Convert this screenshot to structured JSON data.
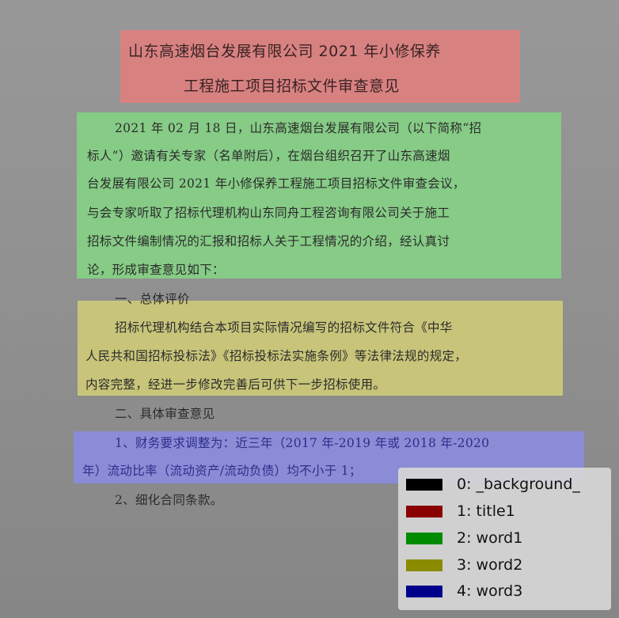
{
  "colors": {
    "background": "#000000",
    "title1": "#8b0000",
    "word1": "#008b00",
    "word2": "#8b8b00",
    "word3": "#00008b"
  },
  "document": {
    "title_lines": [
      "山东高速烟台发展有限公司 2021 年小修保养",
      "工程施工项目招标文件审查意见"
    ],
    "para1_lines": [
      "2021 年 02 月 18 日，山东高速烟台发展有限公司（以下简称“招",
      "标人”）邀请有关专家（名单附后），在烟台组织召开了山东高速烟",
      "台发展有限公司 2021 年小修保养工程施工项目招标文件审查会议，",
      "与会专家听取了招标代理机构山东同舟工程咨询有限公司关于施工",
      "招标文件编制情况的汇报和招标人关于工程情况的介绍，经认真讨",
      "论，形成审查意见如下："
    ],
    "heading1": "一、总体评价",
    "para2_lines": [
      "招标代理机构结合本项目实际情况编写的招标文件符合《中华",
      "人民共和国招标投标法》《招标投标法实施条例》等法律法规的规定，",
      "内容完整，经进一步修改完善后可供下一步招标使用。"
    ],
    "heading2": "二、具体审查意见",
    "para3_lines": [
      "1、财务要求调整为：近三年（2017 年-2019 年或 2018 年-2020",
      "年）流动比率（流动资产/流动负债）均不小于 1；"
    ],
    "item2": "2、细化合同条款。"
  },
  "legend": [
    {
      "label": "0: _background_",
      "color": "#000000"
    },
    {
      "label": "1: title1",
      "color": "#8b0000"
    },
    {
      "label": "2: word1",
      "color": "#008b00"
    },
    {
      "label": "3: word2",
      "color": "#8b8b00"
    },
    {
      "label": "4: word3",
      "color": "#00008b"
    }
  ]
}
